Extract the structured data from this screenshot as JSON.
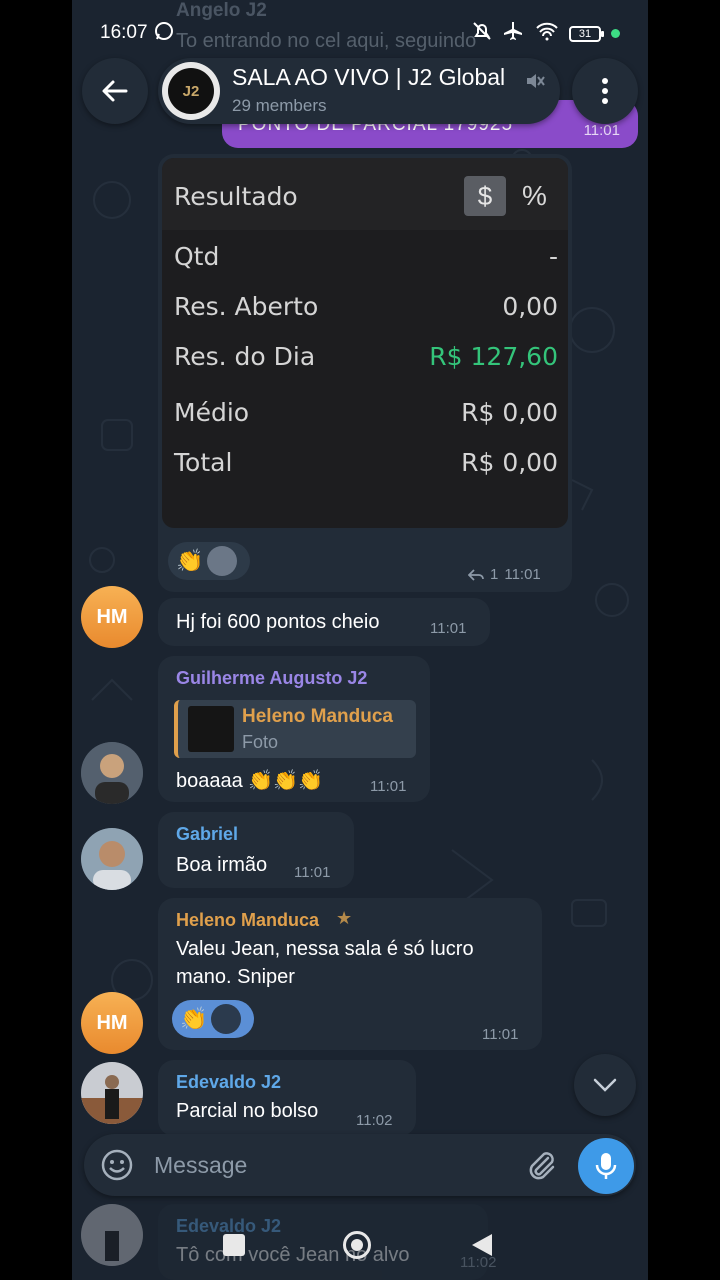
{
  "status_bar": {
    "time": "16:07",
    "battery": "31"
  },
  "header": {
    "title": "SALA AO VIVO | J2 Global",
    "members": "29 members",
    "logo_text": "J2"
  },
  "ghost_top": {
    "sender": "Angelo J2",
    "text": "To entrando no cel aqui, seguindo"
  },
  "outgoing": {
    "text": "PONTO DE PARCIAL 179925",
    "time": "11:01"
  },
  "result_card": {
    "header_label": "Resultado",
    "currency_symbol": "$",
    "percent_symbol": "%",
    "rows": [
      {
        "label": "Qtd",
        "value": "-",
        "color": "#d5d5d5"
      },
      {
        "label": "Res. Aberto",
        "value": "0,00",
        "color": "#d5d5d5"
      },
      {
        "label": "Res. do Dia",
        "value": "R$ 127,60",
        "color": "#34c47a"
      },
      {
        "label": "Médio",
        "value": "R$ 0,00",
        "color": "#d5d5d5"
      },
      {
        "label": "Total",
        "value": "R$ 0,00",
        "color": "#d5d5d5"
      }
    ],
    "reaction_emoji": "👏",
    "reply_count": "1",
    "time": "11:01"
  },
  "messages": [
    {
      "avatar": "HM",
      "text": "Hj foi 600 pontos cheio",
      "time": "11:01"
    },
    {
      "sender": "Guilherme Augusto J2",
      "sender_color": "#9a86e6",
      "reply_to": "Heleno Manduca",
      "reply_sub": "Foto",
      "text": "boaaaa 👏👏👏",
      "time": "11:01"
    },
    {
      "sender": "Gabriel",
      "sender_color": "#5fa8e8",
      "text": "Boa irmão",
      "time": "11:01"
    },
    {
      "sender": "Heleno Manduca",
      "sender_color": "#e0a04c",
      "text_line1": "Valeu Jean, nessa sala é só lucro",
      "text_line2": "mano.  Sniper",
      "reaction_emoji": "👏",
      "avatar": "HM",
      "time": "11:01"
    },
    {
      "sender": "Edevaldo J2",
      "sender_color": "#5fa8e8",
      "text": "Parcial no bolso",
      "time": "11:02"
    }
  ],
  "ghost_bottom": {
    "sender": "Edevaldo J2",
    "text": "Tô com você Jean no alvo",
    "time": "11:02"
  },
  "composer": {
    "placeholder": "Message"
  }
}
